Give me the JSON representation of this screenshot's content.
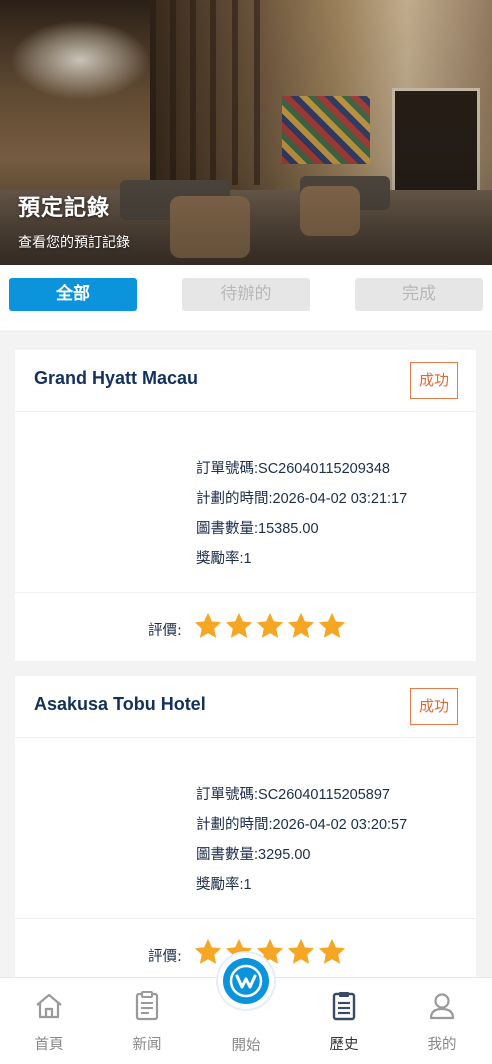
{
  "hero": {
    "title": "預定記錄",
    "subtitle": "查看您的預訂記錄"
  },
  "tabs": [
    {
      "label": "全部",
      "active": true
    },
    {
      "label": "待辦的",
      "active": false
    },
    {
      "label": "完成",
      "active": false
    }
  ],
  "orders": [
    {
      "hotel": "Grand Hyatt Macau",
      "status": "成功",
      "order_no_label": "訂單號碼:",
      "order_no": "SC26040115209348",
      "time_label": "計劃的時間:",
      "time": "2026-04-02 03:21:17",
      "amount_label": "圖書數量:",
      "amount": "15385.00",
      "reward_label": "獎勵率:",
      "reward": "1",
      "rating_label": "評價:",
      "rating": 5
    },
    {
      "hotel": "Asakusa Tobu Hotel",
      "status": "成功",
      "order_no_label": "訂單號碼:",
      "order_no": "SC26040115205897",
      "time_label": "計劃的時間:",
      "time": "2026-04-02 03:20:57",
      "amount_label": "圖書數量:",
      "amount": "3295.00",
      "reward_label": "獎勵率:",
      "reward": "1",
      "rating_label": "評價:",
      "rating": 5
    }
  ],
  "nav": {
    "home": "首頁",
    "news": "新闻",
    "start": "開始",
    "history": "歷史",
    "mine": "我的"
  },
  "colors": {
    "accent": "#0b94dc",
    "star": "#f5a623",
    "status": "#e06a34",
    "title": "#13325b"
  }
}
